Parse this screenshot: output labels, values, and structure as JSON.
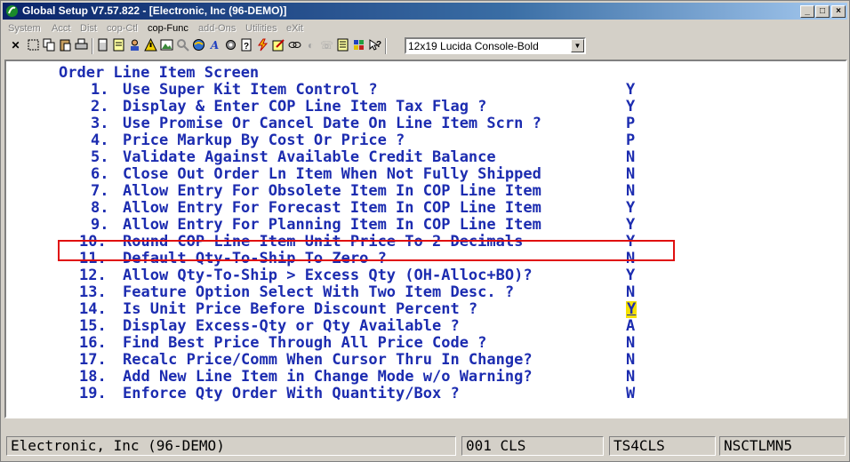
{
  "window": {
    "title": "Global Setup V7.57.822 - [Electronic, Inc (96-DEMO)]",
    "buttons": [
      "_",
      "□",
      "×"
    ]
  },
  "menu": [
    {
      "label": "System",
      "active": false
    },
    {
      "label": "Acct",
      "active": false
    },
    {
      "label": "Dist",
      "active": false
    },
    {
      "label": "cop-Ctl",
      "active": false
    },
    {
      "label": "cop-Func",
      "active": true
    },
    {
      "label": "add-Ons",
      "active": false
    },
    {
      "label": "Utilities",
      "active": false
    },
    {
      "label": "eXit",
      "active": false
    }
  ],
  "toolbar": {
    "icons": [
      "close-icon",
      "select-icon",
      "copy-icon",
      "paste-icon",
      "print-icon",
      "calculator-icon",
      "notes-icon",
      "user-icon",
      "warning-icon",
      "image-icon",
      "search-icon",
      "explorer-icon",
      "font-icon",
      "settings-icon",
      "help-doc-icon",
      "lightning-icon",
      "edit-icon",
      "link-icon",
      "disabled-icon",
      "phone-icon",
      "list-icon",
      "help-icon"
    ],
    "font_select": "12x19 Lucida Console-Bold"
  },
  "screen": {
    "title": "Order Line Item Screen",
    "items": [
      {
        "num": "1.",
        "label": "Use Super Kit Item Control ?",
        "value": "Y"
      },
      {
        "num": "2.",
        "label": "Display & Enter COP Line Item Tax Flag ?",
        "value": "Y"
      },
      {
        "num": "3.",
        "label": "Use Promise Or Cancel Date On Line Item Scrn ?",
        "value": "P"
      },
      {
        "num": "4.",
        "label": "Price Markup By Cost Or Price ?",
        "value": "P"
      },
      {
        "num": "5.",
        "label": "Validate Against Available Credit Balance",
        "value": "N"
      },
      {
        "num": "6.",
        "label": "Close Out Order Ln Item When Not Fully Shipped",
        "value": "N"
      },
      {
        "num": "7.",
        "label": "Allow Entry For Obsolete Item In COP Line Item",
        "value": "N"
      },
      {
        "num": "8.",
        "label": "Allow Entry For Forecast Item In COP Line Item",
        "value": "Y"
      },
      {
        "num": "9.",
        "label": "Allow Entry For Planning Item In COP Line Item",
        "value": "Y"
      },
      {
        "num": "10.",
        "label": "Round COP Line Item Unit Price To 2 Decimals",
        "value": "Y"
      },
      {
        "num": "11.",
        "label": "Default Qty-To-Ship To Zero ?",
        "value": "N"
      },
      {
        "num": "12.",
        "label": "Allow Qty-To-Ship > Excess Qty (OH-Alloc+BO)?",
        "value": "Y"
      },
      {
        "num": "13.",
        "label": "Feature Option Select With Two Item Desc. ?",
        "value": "N"
      },
      {
        "num": "14.",
        "label": "Is Unit Price Before Discount Percent ?",
        "value": "Y"
      },
      {
        "num": "15.",
        "label": "Display Excess-Qty or Qty Available ?",
        "value": "A"
      },
      {
        "num": "16.",
        "label": "Find Best Price Through All Price Code ?",
        "value": "N"
      },
      {
        "num": "17.",
        "label": "Recalc Price/Comm When Cursor Thru In Change?",
        "value": "N"
      },
      {
        "num": "18.",
        "label": "Add New Line Item in Change Mode w/o Warning?",
        "value": "N"
      },
      {
        "num": "19.",
        "label": "Enforce Qty Order With Quantity/Box ?",
        "value": "W"
      }
    ],
    "current_item": 14,
    "highlight_color": "#e01010",
    "cursor_color": "#f5e100"
  },
  "statusbar": {
    "company": "Electronic, Inc (96-DEMO)",
    "code": "001 CLS",
    "terminal": "TS4CLS",
    "program": "NSCTLMN5"
  }
}
